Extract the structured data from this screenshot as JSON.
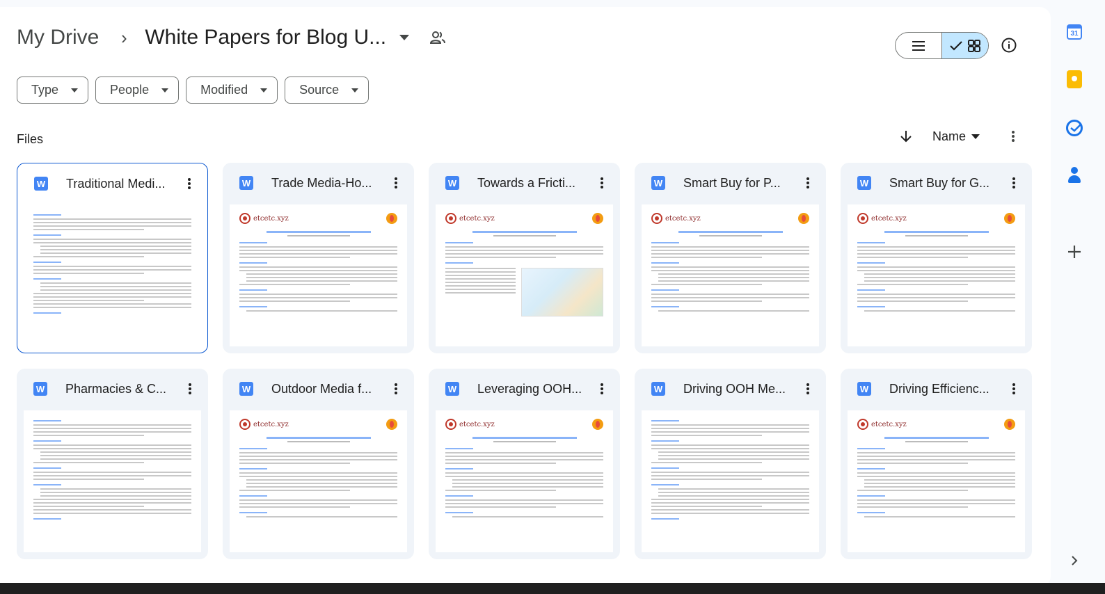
{
  "breadcrumb": {
    "root": "My Drive",
    "separator": "›",
    "current": "White Papers for Blog U..."
  },
  "filters": [
    {
      "label": "Type"
    },
    {
      "label": "People"
    },
    {
      "label": "Modified"
    },
    {
      "label": "Source"
    }
  ],
  "files_header": {
    "label": "Files",
    "sort_label": "Name"
  },
  "files": [
    {
      "name": "Traditional Medi...",
      "selected": true
    },
    {
      "name": "Trade Media-Ho..."
    },
    {
      "name": "Towards a Fricti..."
    },
    {
      "name": "Smart Buy for P..."
    },
    {
      "name": "Smart Buy for G..."
    },
    {
      "name": "Pharmacies & C..."
    },
    {
      "name": "Outdoor Media f..."
    },
    {
      "name": "Leveraging OOH..."
    },
    {
      "name": "Driving OOH Me..."
    },
    {
      "name": "Driving Efficienc..."
    }
  ],
  "thumbnail_brand": "etcetc.xyz",
  "file_type_badge": "W",
  "side_panel": {
    "calendar_day": "31"
  },
  "icons": {
    "caret": "caret-down-icon",
    "share": "people-icon",
    "list_view": "list-view-icon",
    "grid_view": "grid-view-icon",
    "info": "info-icon",
    "sort_direction": "arrow-down-icon",
    "more": "more-vert-icon",
    "add": "plus-icon",
    "expand": "chevron-right-icon"
  },
  "colors": {
    "accent": "#0b57d0",
    "toggle_active": "#c2e7ff",
    "card_bg": "#f0f4f9",
    "word_blue": "#4285f4"
  }
}
